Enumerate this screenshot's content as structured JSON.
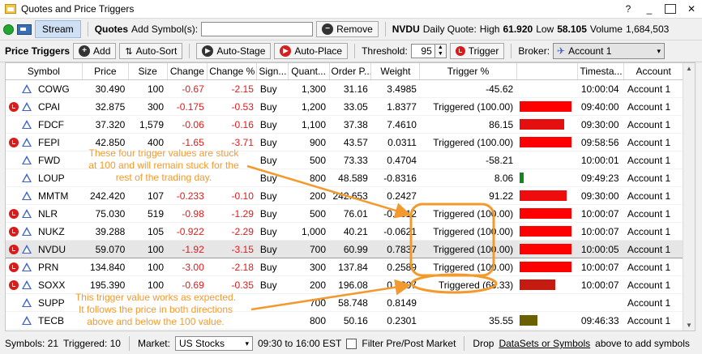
{
  "window": {
    "title": "Quotes and Price Triggers",
    "controls": [
      "?",
      "_",
      "□",
      "✕"
    ]
  },
  "toolbar1": {
    "stream_label": "Stream",
    "quotes_label": "Quotes",
    "add_symbol_label": "Add Symbol(s):",
    "add_symbol_value": "",
    "remove_label": "Remove",
    "quote_symbol": "NVDU",
    "quote_label": "Daily Quote:",
    "high_label": "High",
    "high_value": "61.920",
    "low_label": "Low",
    "low_value": "58.105",
    "volume_label": "Volume",
    "volume_value": "1,684,503"
  },
  "toolbar2": {
    "title": "Price Triggers",
    "add_label": "Add",
    "auto_sort_label": "Auto-Sort",
    "auto_stage_label": "Auto-Stage",
    "auto_place_label": "Auto-Place",
    "threshold_label": "Threshold:",
    "threshold_value": "95",
    "trigger_label": "Trigger",
    "broker_label": "Broker:",
    "broker_value": "Account 1"
  },
  "table": {
    "columns": [
      "Symbol",
      "Price",
      "Size",
      "Change",
      "Change %",
      "Sign...",
      "Quant...",
      "Order P...",
      "Weight",
      "Trigger %",
      "",
      "Timesta...",
      "Account"
    ],
    "rows": [
      {
        "alarm": false,
        "symbol": "COWG",
        "price": "30.490",
        "size": "100",
        "change": "-0.67",
        "change_pct": "-2.15",
        "signal": "Buy",
        "quantity": "1,300",
        "order_price": "31.16",
        "weight": "3.4985",
        "trigger": "-45.62",
        "bar_pct": 0,
        "bar_color": "",
        "timestamp": "10:00:04",
        "account": "Account 1"
      },
      {
        "alarm": true,
        "symbol": "CPAI",
        "price": "32.875",
        "size": "300",
        "change": "-0.175",
        "change_pct": "-0.53",
        "signal": "Buy",
        "quantity": "1,200",
        "order_price": "33.05",
        "weight": "1.8377",
        "trigger": "Triggered (100.00)",
        "bar_pct": 100,
        "bar_color": "#ff0000",
        "timestamp": "09:40:00",
        "account": "Account 1"
      },
      {
        "alarm": false,
        "symbol": "FDCF",
        "price": "37.320",
        "size": "1,579",
        "change": "-0.06",
        "change_pct": "-0.16",
        "signal": "Buy",
        "quantity": "1,100",
        "order_price": "37.38",
        "weight": "7.4610",
        "trigger": "86.15",
        "bar_pct": 86,
        "bar_color": "#e41010",
        "timestamp": "09:30:00",
        "account": "Account 1"
      },
      {
        "alarm": true,
        "symbol": "FEPI",
        "price": "42.850",
        "size": "400",
        "change": "-1.65",
        "change_pct": "-3.71",
        "signal": "Buy",
        "quantity": "900",
        "order_price": "43.57",
        "weight": "0.0311",
        "trigger": "Triggered (100.00)",
        "bar_pct": 100,
        "bar_color": "#ff0000",
        "timestamp": "09:58:56",
        "account": "Account 1"
      },
      {
        "alarm": false,
        "symbol": "FWD",
        "price": "",
        "size": "",
        "change": "",
        "change_pct": "",
        "signal": "Buy",
        "quantity": "500",
        "order_price": "73.33",
        "weight": "0.4704",
        "trigger": "-58.21",
        "bar_pct": 0,
        "bar_color": "",
        "timestamp": "10:00:01",
        "account": "Account 1"
      },
      {
        "alarm": false,
        "symbol": "LOUP",
        "price": "",
        "size": "",
        "change": "",
        "change_pct": "",
        "signal": "Buy",
        "quantity": "800",
        "order_price": "48.589",
        "weight": "-0.8316",
        "trigger": "8.06",
        "bar_pct": 8,
        "bar_color": "#0d8a1a",
        "timestamp": "09:49:23",
        "account": "Account 1"
      },
      {
        "alarm": false,
        "symbol": "MMTM",
        "price": "242.420",
        "size": "107",
        "change": "-0.233",
        "change_pct": "-0.10",
        "signal": "Buy",
        "quantity": "200",
        "order_price": "242.653",
        "weight": "0.2427",
        "trigger": "91.22",
        "bar_pct": 91,
        "bar_color": "#ee0c0c",
        "timestamp": "09:30:00",
        "account": "Account 1"
      },
      {
        "alarm": true,
        "symbol": "NLR",
        "price": "75.030",
        "size": "519",
        "change": "-0.98",
        "change_pct": "-1.29",
        "signal": "Buy",
        "quantity": "500",
        "order_price": "76.01",
        "weight": "-0.6312",
        "trigger": "Triggered (100.00)",
        "bar_pct": 100,
        "bar_color": "#ff0000",
        "timestamp": "10:00:07",
        "account": "Account 1"
      },
      {
        "alarm": true,
        "symbol": "NUKZ",
        "price": "39.288",
        "size": "105",
        "change": "-0.922",
        "change_pct": "-2.29",
        "signal": "Buy",
        "quantity": "1,000",
        "order_price": "40.21",
        "weight": "-0.0621",
        "trigger": "Triggered (100.00)",
        "bar_pct": 100,
        "bar_color": "#ff0000",
        "timestamp": "10:00:07",
        "account": "Account 1"
      },
      {
        "alarm": true,
        "symbol": "NVDU",
        "price": "59.070",
        "size": "100",
        "change": "-1.92",
        "change_pct": "-3.15",
        "signal": "Buy",
        "quantity": "700",
        "order_price": "60.99",
        "weight": "0.7837",
        "trigger": "Triggered (100.00)",
        "bar_pct": 100,
        "bar_color": "#ff0000",
        "timestamp": "10:00:05",
        "account": "Account 1",
        "selected": true
      },
      {
        "alarm": true,
        "symbol": "PRN",
        "price": "134.840",
        "size": "100",
        "change": "-3.00",
        "change_pct": "-2.18",
        "signal": "Buy",
        "quantity": "300",
        "order_price": "137.84",
        "weight": "0.2589",
        "trigger": "Triggered (100.00)",
        "bar_pct": 100,
        "bar_color": "#ff0000",
        "timestamp": "10:00:07",
        "account": "Account 1"
      },
      {
        "alarm": true,
        "symbol": "SOXX",
        "price": "195.390",
        "size": "100",
        "change": "-0.69",
        "change_pct": "-0.35",
        "signal": "Buy",
        "quantity": "200",
        "order_price": "196.08",
        "weight": "0.9807",
        "trigger": "Triggered (68.33)",
        "bar_pct": 68,
        "bar_color": "#c51b10",
        "timestamp": "10:00:07",
        "account": "Account 1"
      },
      {
        "alarm": false,
        "symbol": "SUPP",
        "price": "",
        "size": "",
        "change": "",
        "change_pct": "",
        "signal": "",
        "quantity": "700",
        "order_price": "58.748",
        "weight": "0.8149",
        "trigger": "",
        "bar_pct": 0,
        "bar_color": "",
        "timestamp": "",
        "account": "Account 1"
      },
      {
        "alarm": false,
        "symbol": "TECB",
        "price": "",
        "size": "",
        "change": "",
        "change_pct": "",
        "signal": "",
        "quantity": "800",
        "order_price": "50.16",
        "weight": "0.2301",
        "trigger": "35.55",
        "bar_pct": 35,
        "bar_color": "#6b6000",
        "timestamp": "09:46:33",
        "account": "Account 1"
      }
    ]
  },
  "annotations": {
    "note1": [
      "These four trigger values are stuck",
      "at 100 and will remain stuck for the",
      "rest of the trading day."
    ],
    "note2": [
      "This trigger value works as expected.",
      "It follows the price in both directions",
      "above and below the 100 value."
    ],
    "color": "#f29a2e"
  },
  "statusbar": {
    "symbols": "Symbols: 21",
    "triggered": "Triggered: 10",
    "market_label": "Market:",
    "market_value": "US Stocks",
    "hours": "09:30 to 16:00 EST",
    "filter_label": "Filter Pre/Post Market",
    "drop_prefix": "Drop",
    "drop_link": "DataSets or Symbols",
    "drop_suffix": "above to add symbols"
  }
}
